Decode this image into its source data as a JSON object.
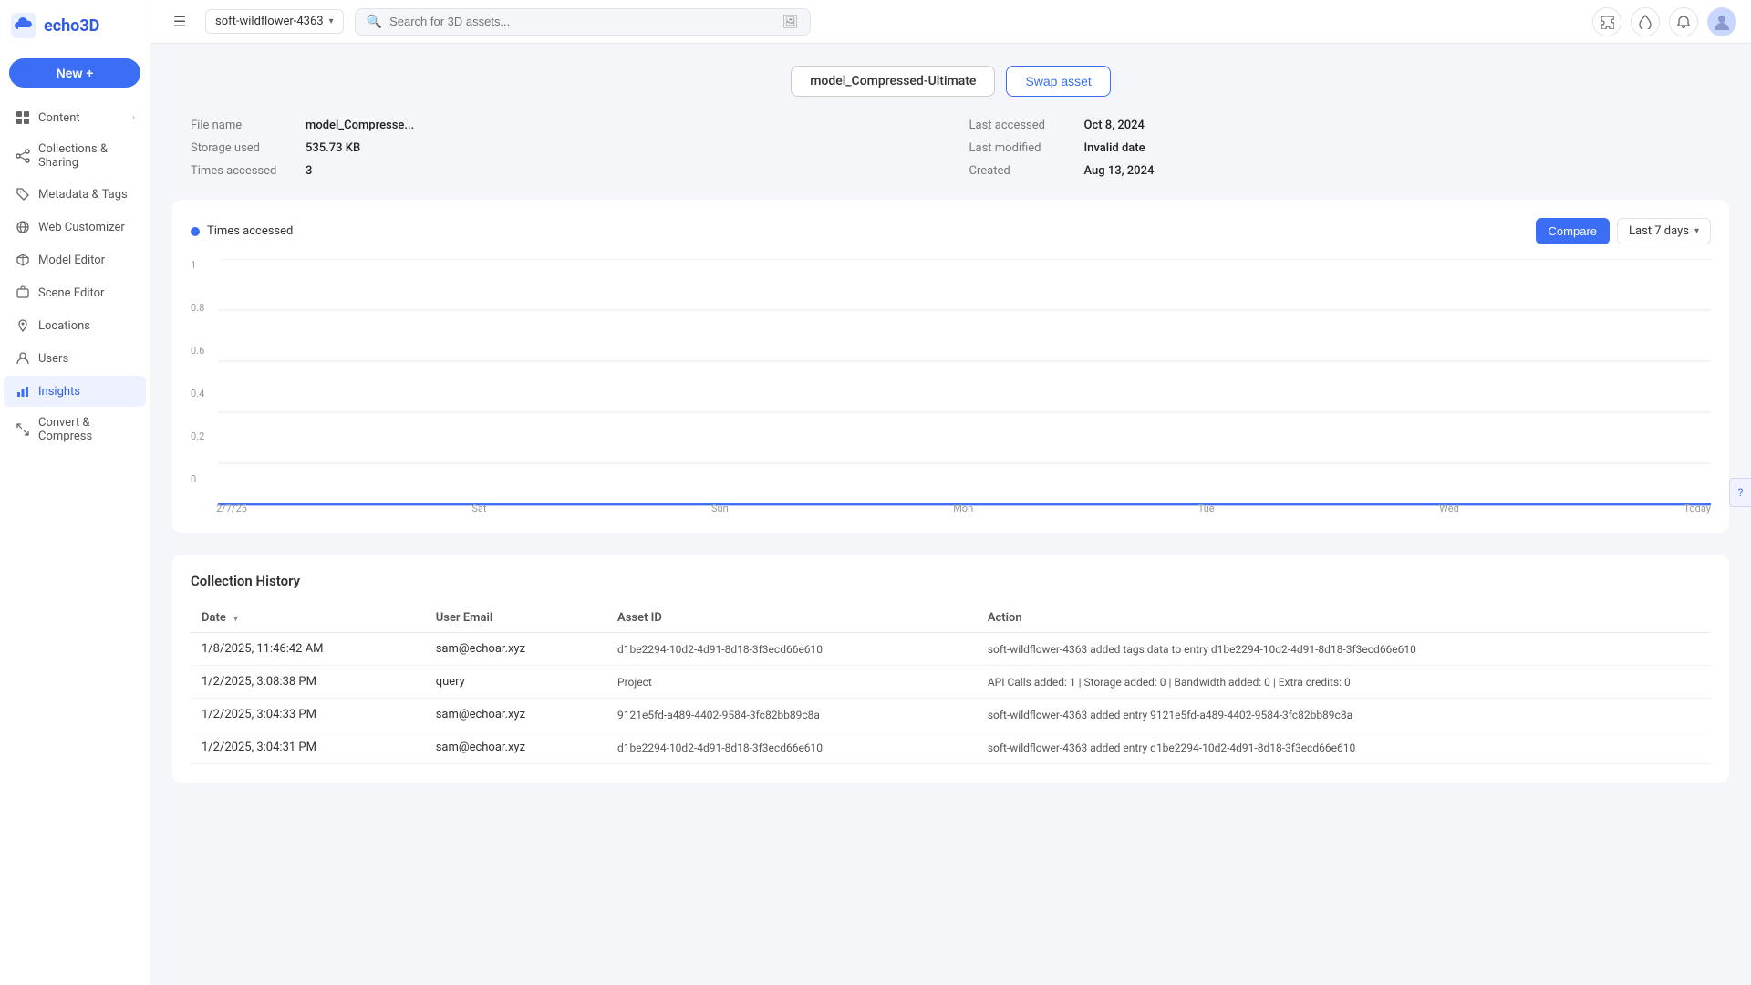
{
  "logo": {
    "text": "echo3D"
  },
  "sidebar": {
    "new_button": "New +",
    "items": [
      {
        "id": "content",
        "label": "Content",
        "icon": "grid",
        "has_arrow": true,
        "active": false
      },
      {
        "id": "collections-sharing",
        "label": "Collections & Sharing",
        "icon": "share",
        "has_arrow": false,
        "active": false
      },
      {
        "id": "metadata-tags",
        "label": "Metadata & Tags",
        "icon": "tag",
        "has_arrow": false,
        "active": false
      },
      {
        "id": "web-customizer",
        "label": "Web Customizer",
        "icon": "globe",
        "has_arrow": false,
        "active": false
      },
      {
        "id": "model-editor",
        "label": "Model Editor",
        "icon": "edit",
        "has_arrow": false,
        "active": false
      },
      {
        "id": "scene-editor",
        "label": "Scene Editor",
        "icon": "scene",
        "has_arrow": false,
        "active": false
      },
      {
        "id": "locations",
        "label": "Locations",
        "icon": "map-pin",
        "has_arrow": false,
        "active": false
      },
      {
        "id": "users",
        "label": "Users",
        "icon": "user",
        "has_arrow": false,
        "active": false
      },
      {
        "id": "insights",
        "label": "Insights",
        "icon": "bar-chart",
        "has_arrow": false,
        "active": true
      },
      {
        "id": "convert-compress",
        "label": "Convert & Compress",
        "icon": "compress",
        "has_arrow": false,
        "active": false
      }
    ]
  },
  "topbar": {
    "workspace": "soft-wildflower-4363",
    "search_placeholder": "Search for 3D assets...",
    "icons": [
      "puzzle",
      "drop",
      "bell"
    ],
    "avatar": "👤"
  },
  "asset": {
    "name": "model_Compressed-Ultimate",
    "swap_btn": "Swap asset",
    "meta": {
      "file_name_label": "File name",
      "file_name_value": "model_Compresse...",
      "storage_used_label": "Storage used",
      "storage_used_value": "535.73 KB",
      "times_accessed_label": "Times accessed",
      "times_accessed_value": "3",
      "last_accessed_label": "Last accessed",
      "last_accessed_value": "Oct 8, 2024",
      "last_modified_label": "Last modified",
      "last_modified_value": "Invalid date",
      "created_label": "Created",
      "created_value": "Aug 13, 2024"
    }
  },
  "chart": {
    "legend_label": "Times accessed",
    "compare_btn": "Compare",
    "timerange_label": "Last 7 days",
    "y_labels": [
      "1",
      "0.8",
      "0.6",
      "0.4",
      "0.2",
      "0"
    ],
    "x_labels": [
      "2/7/25",
      "Sat",
      "Sun",
      "Mon",
      "Tue",
      "Wed",
      "Today"
    ],
    "accent_color": "#3b6ef5"
  },
  "table": {
    "title": "Collection History",
    "columns": [
      "Date",
      "User Email",
      "Asset ID",
      "Action"
    ],
    "rows": [
      {
        "date": "1/8/2025, 11:46:42 AM",
        "user_email": "sam@echoar.xyz",
        "asset_id": "d1be2294-10d2-4d91-8d18-3f3ecd66e610",
        "action": "soft-wildflower-4363 added tags data to entry d1be2294-10d2-4d91-8d18-3f3ecd66e610"
      },
      {
        "date": "1/2/2025, 3:08:38 PM",
        "user_email": "query",
        "asset_id": "Project",
        "action": "API Calls added: 1 | Storage added: 0 | Bandwidth added: 0 | Extra credits: 0"
      },
      {
        "date": "1/2/2025, 3:04:33 PM",
        "user_email": "sam@echoar.xyz",
        "asset_id": "9121e5fd-a489-4402-9584-3fc82bb89c8a",
        "action": "soft-wildflower-4363 added entry 9121e5fd-a489-4402-9584-3fc82bb89c8a"
      },
      {
        "date": "1/2/2025, 3:04:31 PM",
        "user_email": "sam@echoar.xyz",
        "asset_id": "d1be2294-10d2-4d91-8d18-3f3ecd66e610",
        "action": "soft-wildflower-4363 added entry d1be2294-10d2-4d91-8d18-3f3ecd66e610"
      }
    ]
  }
}
